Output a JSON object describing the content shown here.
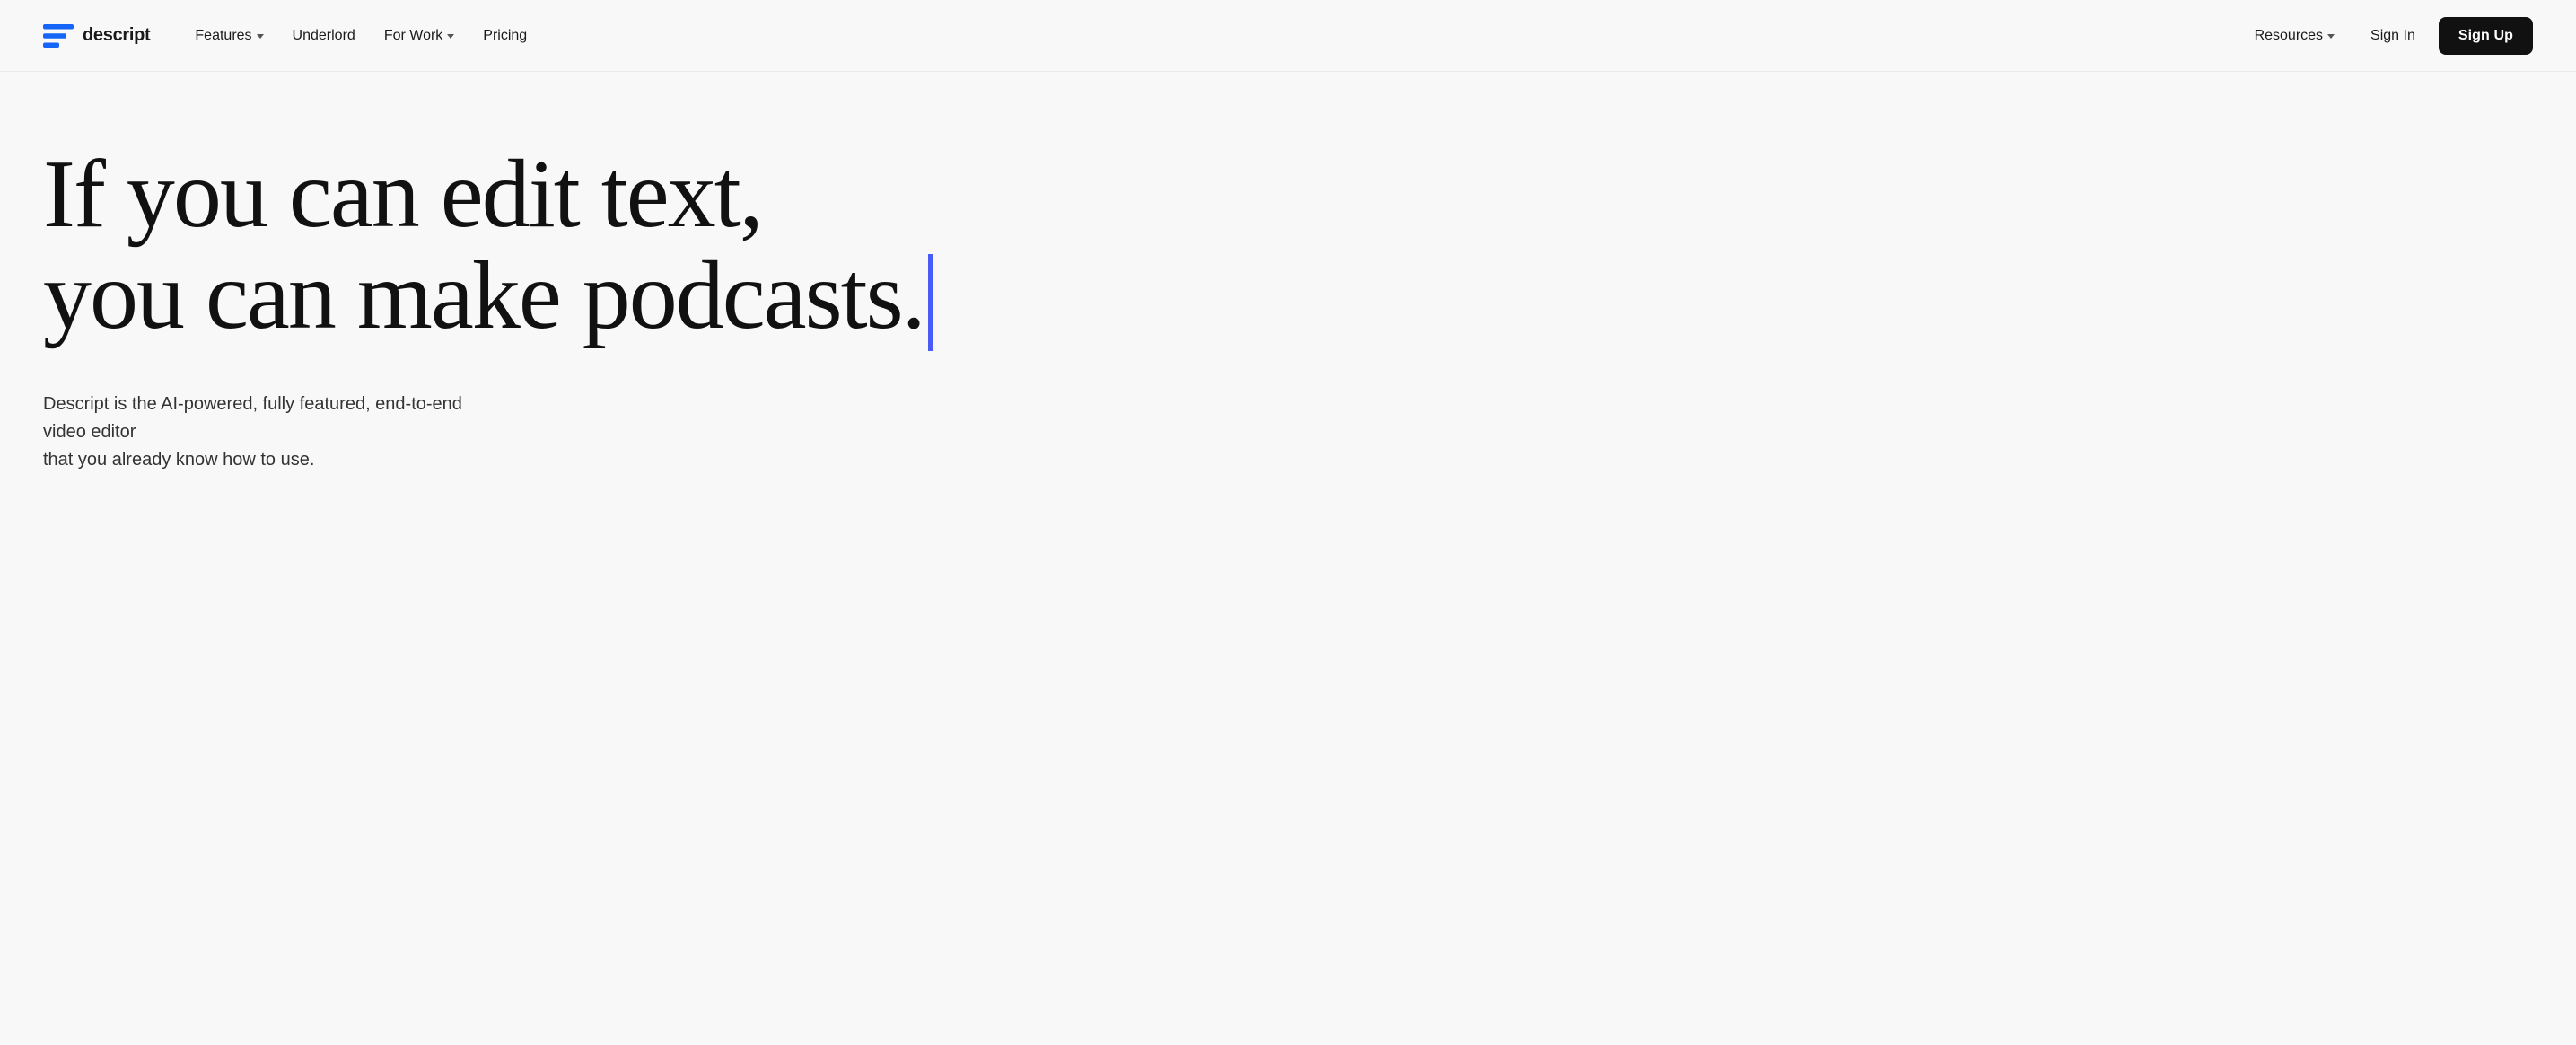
{
  "brand": {
    "logo_text": "descript",
    "logo_icon_alt": "descript-logo"
  },
  "nav": {
    "left_links": [
      {
        "id": "features",
        "label": "Features",
        "has_dropdown": true
      },
      {
        "id": "underlord",
        "label": "Underlord",
        "has_dropdown": false
      },
      {
        "id": "for-work",
        "label": "For Work",
        "has_dropdown": true
      },
      {
        "id": "pricing",
        "label": "Pricing",
        "has_dropdown": false
      }
    ],
    "right_links": [
      {
        "id": "resources",
        "label": "Resources",
        "has_dropdown": true
      },
      {
        "id": "signin",
        "label": "Sign In",
        "has_dropdown": false
      },
      {
        "id": "signup",
        "label": "Sign Up",
        "has_dropdown": false
      }
    ]
  },
  "hero": {
    "headline_line1": "If you can edit text,",
    "headline_line2": "you can make podcasts.",
    "cursor_color": "#4A5CF6",
    "subtext_line1": "Descript is the AI-powered, fully featured, end-to-end video editor",
    "subtext_line2": "that you already know how to use."
  }
}
